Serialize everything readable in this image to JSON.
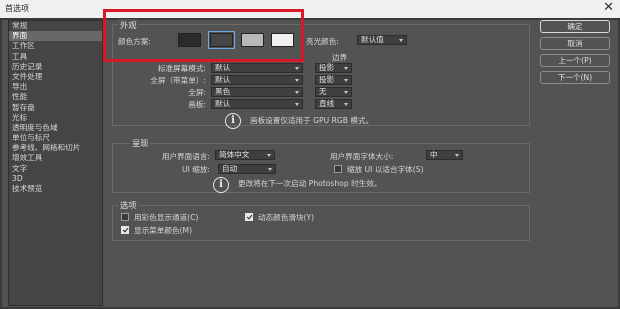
{
  "window": {
    "title": "首选项",
    "close_glyph": "✕"
  },
  "sidebar": {
    "items": [
      {
        "label": "常规",
        "active": false
      },
      {
        "label": "界面",
        "active": true
      },
      {
        "label": "工作区",
        "active": false
      },
      {
        "label": "工具",
        "active": false
      },
      {
        "label": "历史记录",
        "active": false
      },
      {
        "label": "文件处理",
        "active": false
      },
      {
        "label": "导出",
        "active": false
      },
      {
        "label": "性能",
        "active": false
      },
      {
        "label": "暂存盘",
        "active": false
      },
      {
        "label": "光标",
        "active": false
      },
      {
        "label": "透明度与色域",
        "active": false
      },
      {
        "label": "单位与标尺",
        "active": false
      },
      {
        "label": "参考线、网格和切片",
        "active": false
      },
      {
        "label": "增效工具",
        "active": false
      },
      {
        "label": "文字",
        "active": false
      },
      {
        "label": "3D",
        "active": false
      },
      {
        "label": "技术预览",
        "active": false
      }
    ]
  },
  "appearance": {
    "title": "外观",
    "color_scheme_label": "颜色方案:",
    "swatch_colors": [
      "#2a2a2a",
      "#454545",
      "#b8b8b8",
      "#f0f0f0"
    ],
    "selected_swatch": 1,
    "highlight_label": "亮光颜色:",
    "highlight_value": "默认值",
    "border_header": "边界",
    "rows": [
      {
        "label": "标准屏幕模式:",
        "color": "默认",
        "border": "投影"
      },
      {
        "label": "全屏（带菜单）:",
        "color": "默认",
        "border": "投影"
      },
      {
        "label": "全屏:",
        "color": "黑色",
        "border": "无"
      },
      {
        "label": "画板:",
        "color": "默认",
        "border": "直线"
      }
    ],
    "note": "画板设置仅适用于 GPU RGB 模式。"
  },
  "presentation": {
    "title": "呈现",
    "ui_language_label": "用户界面语言:",
    "ui_language_value": "简体中文",
    "ui_font_size_label": "用户界面字体大小:",
    "ui_font_size_value": "中",
    "ui_scale_label": "UI 缩放:",
    "ui_scale_value": "自动",
    "scale_fonts_label": "缩放 UI 以适合字体(S)",
    "note": "更改将在下一次启动 Photoshop 时生效。"
  },
  "options": {
    "title": "选项",
    "items": [
      {
        "label": "用彩色显示通道(C)",
        "checked": false
      },
      {
        "label": "动态颜色滑块(Y)",
        "checked": true
      },
      {
        "label": "显示菜单颜色(M)",
        "checked": true
      }
    ]
  },
  "buttons": {
    "ok": "确定",
    "cancel": "取消",
    "prev": "上一个(P)",
    "next": "下一个(N)"
  },
  "colors": {
    "panel_bg": "#535353",
    "sidebar_active": "#686868",
    "highlight_border": "#d8182a"
  }
}
